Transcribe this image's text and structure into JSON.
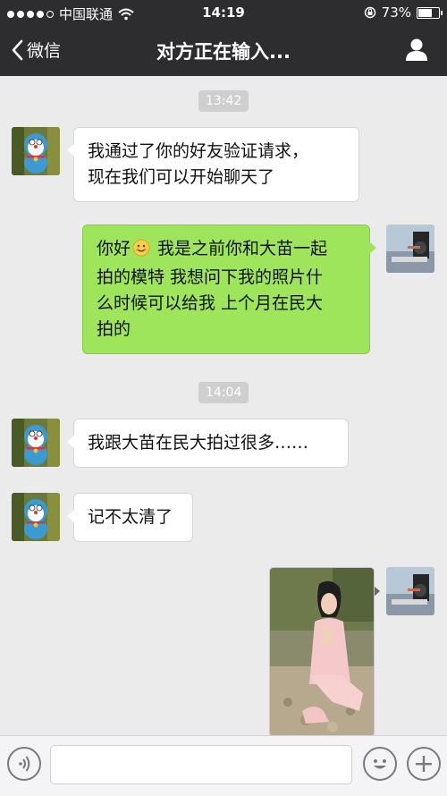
{
  "status_bar": {
    "carrier": "中国联通",
    "time": "14:19",
    "battery_percent": "73%",
    "battery_level": 0.73,
    "signal_bars_filled": 4,
    "signal_bars_total": 5
  },
  "nav": {
    "back_label": "微信",
    "title": "对方正在输入..."
  },
  "messages": [
    {
      "kind": "timestamp",
      "text": "13:42"
    },
    {
      "kind": "text",
      "side": "left",
      "lines": [
        "我通过了你的好友验证请求，",
        "现在我们可以开始聊天了"
      ]
    },
    {
      "kind": "text",
      "side": "right",
      "line1_before_emoji": "你好",
      "line1_after_emoji": " 我是之前你和大苗一起",
      "lines_rest": [
        "拍的模特 我想问下我的照片什",
        "么时候可以给我 上个月在民大",
        "拍的"
      ],
      "emoji": "smile-emoji"
    },
    {
      "kind": "timestamp",
      "text": "14:04"
    },
    {
      "kind": "text",
      "side": "left",
      "lines": [
        "我跟大苗在民大拍过很多……"
      ]
    },
    {
      "kind": "text",
      "side": "left",
      "lines": [
        "记不太清了"
      ]
    },
    {
      "kind": "image",
      "side": "right",
      "description_icon": "photo-image"
    }
  ],
  "input_bar": {
    "voice_icon": "voice-icon",
    "emoji_icon": "emoji-icon",
    "plus_icon": "plus-icon",
    "placeholder": ""
  },
  "colors": {
    "nav_bg": "#2d2d30",
    "chat_bg": "#ebebeb",
    "bubble_self": "#9ee55c",
    "bubble_other": "#ffffff",
    "timestamp_bg": "#cfcfcf"
  }
}
